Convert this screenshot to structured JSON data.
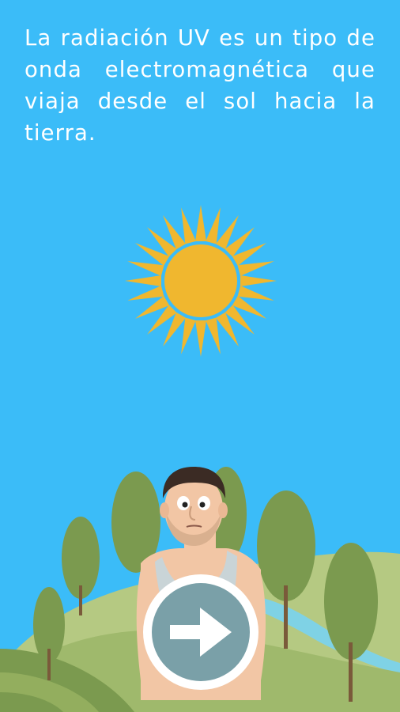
{
  "intro": {
    "text": "La radiación UV es un tipo de onda electromagnética que viaja desde el sol hacia la tierra."
  },
  "colors": {
    "sky": "#3bbcf8",
    "sun": "#f0b72f",
    "hills_light": "#b5c982",
    "hills_mid": "#9fb96c",
    "trees": "#7b9a4f",
    "river": "#7fd2e5",
    "button_fill": "#7aa0a8",
    "button_ring": "#ffffff"
  },
  "icons": {
    "sun": "sun-icon",
    "next": "arrow-right-icon"
  }
}
